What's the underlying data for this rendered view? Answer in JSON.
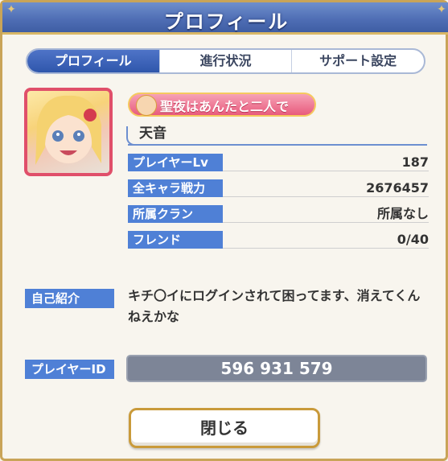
{
  "dialog": {
    "title": "プロフィール"
  },
  "tabs": [
    {
      "label": "プロフィール",
      "active": true
    },
    {
      "label": "進行状況",
      "active": false
    },
    {
      "label": "サポート設定",
      "active": false
    }
  ],
  "profile": {
    "title_badge": "聖夜はあんたと二人で",
    "name": "天音",
    "stats": [
      {
        "label": "プレイヤーLv",
        "value": "187"
      },
      {
        "label": "全キャラ戦力",
        "value": "2676457"
      },
      {
        "label": "所属クラン",
        "value": "所属なし"
      },
      {
        "label": "フレンド",
        "value": "0/40"
      }
    ],
    "self_intro_label": "自己紹介",
    "self_intro": "キチ〇イにログインされて困ってます、消えてくんねえかな",
    "player_id_label": "プレイヤーID",
    "player_id": "596 931 579"
  },
  "buttons": {
    "close_label": "閉じる"
  },
  "colors": {
    "accent": "#4f80d6",
    "frame": "#c9a458",
    "badge": "#e85b7d"
  }
}
